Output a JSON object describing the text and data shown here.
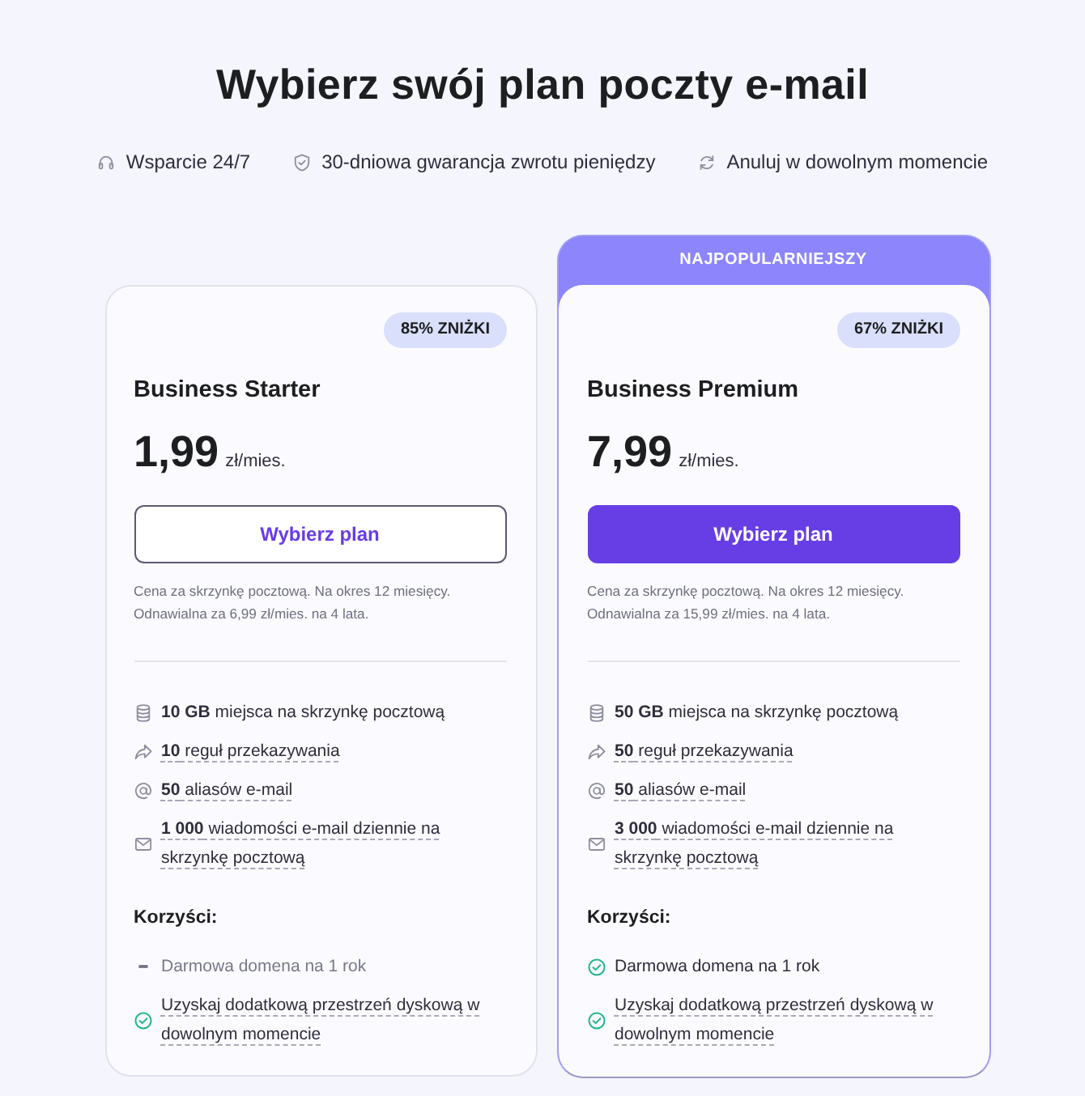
{
  "page": {
    "title": "Wybierz swój plan poczty e-mail"
  },
  "guarantees": [
    "Wsparcie 24/7",
    "30-dniowa gwarancja zwrotu pieniędzy",
    "Anuluj w dowolnym momencie"
  ],
  "plans": [
    {
      "featured": false,
      "discount": "85% ZNIŻKI",
      "name": "Business Starter",
      "price": "1,99",
      "price_unit": "zł/mies.",
      "button": "Wybierz plan",
      "note": [
        "Cena za skrzynkę pocztową. Na okres 12 miesięcy.",
        "Odnawialna za 6,99 zł/mies. na 4 lata."
      ],
      "features": [
        {
          "text": "**10 GB** miejsca na skrzynkę pocztową",
          "underlined": false
        },
        {
          "text": "**10** reguł przekazywania",
          "underlined": true
        },
        {
          "text": "**50** aliasów e-mail",
          "underlined": true
        },
        {
          "text": "**1 000** wiadomości e-mail dziennie na skrzynkę pocztową",
          "underlined": true
        }
      ],
      "benefits_title": "Korzyści:",
      "benefits": [
        {
          "text": "Darmowa domena na 1 rok",
          "included": false,
          "underlined": false
        },
        {
          "text": "Uzyskaj dodatkową przestrzeń dyskową w dowolnym momencie",
          "included": true,
          "underlined": true
        }
      ]
    },
    {
      "featured": true,
      "ribbon": "NAJPOPULARNIEJSZY",
      "discount": "67% ZNIŻKI",
      "name": "Business Premium",
      "price": "7,99",
      "price_unit": "zł/mies.",
      "button": "Wybierz plan",
      "note": [
        "Cena za skrzynkę pocztową. Na okres 12 miesięcy.",
        "Odnawialna za 15,99 zł/mies. na 4 lata."
      ],
      "features": [
        {
          "text": "**50 GB** miejsca na skrzynkę pocztową",
          "underlined": false
        },
        {
          "text": "**50** reguł przekazywania",
          "underlined": true
        },
        {
          "text": "**50** aliasów e-mail",
          "underlined": true
        },
        {
          "text": "**3 000** wiadomości e-mail dziennie na skrzynkę pocztową",
          "underlined": true
        }
      ],
      "benefits_title": "Korzyści:",
      "benefits": [
        {
          "text": "Darmowa domena na 1 rok",
          "included": true,
          "underlined": false
        },
        {
          "text": "Uzyskaj dodatkową przestrzeń dyskową w dowolnym momencie",
          "included": true,
          "underlined": true
        }
      ]
    }
  ]
}
